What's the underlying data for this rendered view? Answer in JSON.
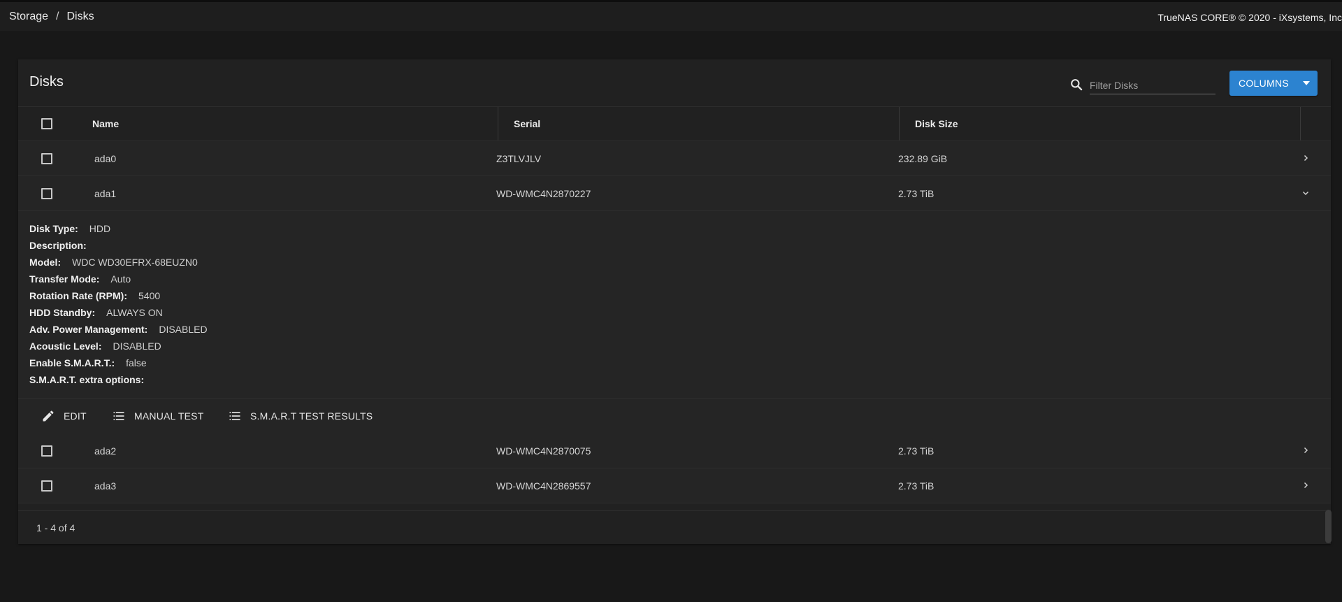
{
  "topbar": {
    "breadcrumb": [
      "Storage",
      "Disks"
    ],
    "copyright": "TrueNAS CORE® © 2020 - iXsystems, Inc"
  },
  "card": {
    "title": "Disks",
    "filter_placeholder": "Filter Disks",
    "columns_label": "COLUMNS"
  },
  "table": {
    "headers": [
      "Name",
      "Serial",
      "Disk Size"
    ],
    "rows": [
      {
        "name": "ada0",
        "serial": "Z3TLVJLV",
        "size": "232.89 GiB"
      },
      {
        "name": "ada1",
        "serial": "WD-WMC4N2870227",
        "size": "2.73 TiB"
      },
      {
        "name": "ada2",
        "serial": "WD-WMC4N2870075",
        "size": "2.73 TiB"
      },
      {
        "name": "ada3",
        "serial": "WD-WMC4N2869557",
        "size": "2.73 TiB"
      }
    ]
  },
  "detail": {
    "items": [
      {
        "key": "Disk Type:",
        "value": "HDD"
      },
      {
        "key": "Description:",
        "value": ""
      },
      {
        "key": "Model:",
        "value": "WDC WD30EFRX-68EUZN0"
      },
      {
        "key": "Transfer Mode:",
        "value": "Auto"
      },
      {
        "key": "Rotation Rate (RPM):",
        "value": "5400"
      },
      {
        "key": "HDD Standby:",
        "value": "ALWAYS ON"
      },
      {
        "key": "Adv. Power Management:",
        "value": "DISABLED"
      },
      {
        "key": "Acoustic Level:",
        "value": "DISABLED"
      },
      {
        "key": "Enable S.M.A.R.T.:",
        "value": "false"
      },
      {
        "key": "S.M.A.R.T. extra options:",
        "value": ""
      }
    ],
    "actions": {
      "edit": "EDIT",
      "manual_test": "MANUAL TEST",
      "smart_results": "S.M.A.R.T TEST RESULTS"
    }
  },
  "footer": {
    "range": "1 - 4 of 4"
  },
  "icons": {
    "search": "search-icon",
    "dropdown": "caret-down-icon",
    "expand": "chevron-right-icon",
    "collapse": "chevron-down-icon",
    "edit": "pencil-icon",
    "list": "list-icon"
  },
  "colors": {
    "accent": "#2c83d0",
    "background": "#181818",
    "card": "#212121"
  }
}
